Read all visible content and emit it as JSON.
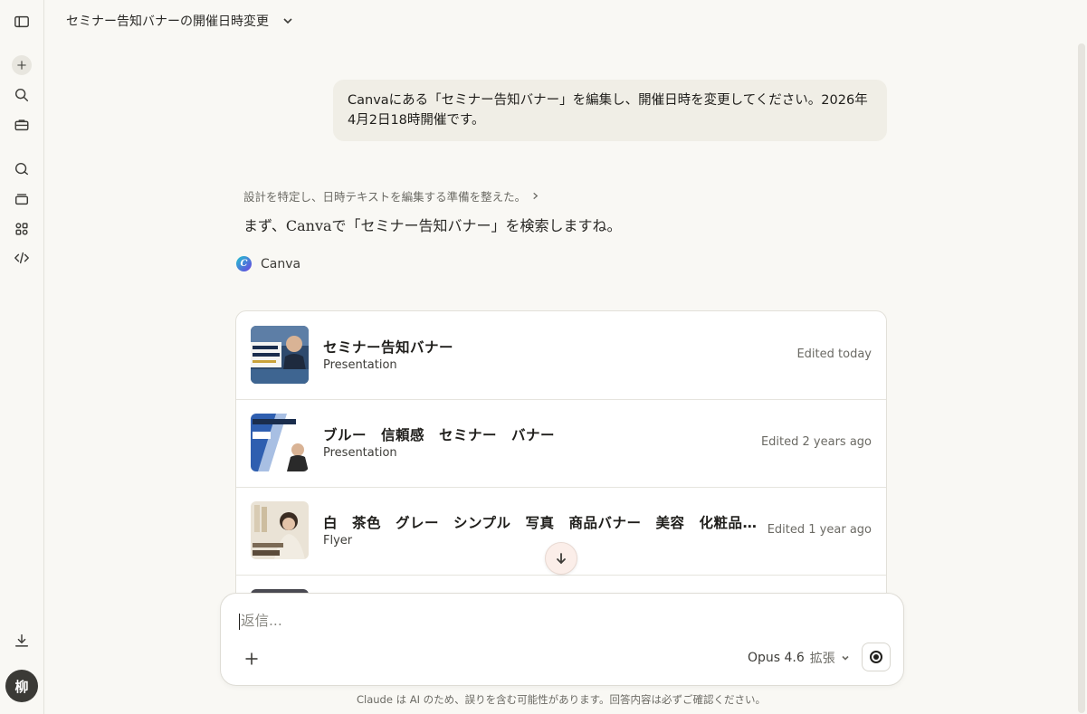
{
  "header": {
    "title": "セミナー告知バナーの開催日時変更"
  },
  "sidebar": {
    "icons": [
      "sidebar-toggle-icon",
      "new-chat-icon",
      "search-icon",
      "toolbox-icon",
      "chats-icon",
      "projects-icon",
      "artifacts-icon",
      "code-icon",
      "download-icon"
    ],
    "avatar_initial": "柳"
  },
  "conversation": {
    "user_message": "Canvaにある「セミナー告知バナー」を編集し、開催日時を変更してください。2026年4月2日18時開催です。",
    "thinking_summary": "設計を特定し、日時テキストを編集する準備を整えた。",
    "assistant_text": "まず、Canvaで「セミナー告知バナー」を検索しますね。",
    "tool_name": "Canva",
    "tool_logo_letter": "C"
  },
  "results": [
    {
      "title": "セミナー告知バナー",
      "type": "Presentation",
      "edited": "Edited today"
    },
    {
      "title": "ブルー　信頼感　セミナー　バナー",
      "type": "Presentation",
      "edited": "Edited 2 years ago"
    },
    {
      "title": "白　茶色　グレー　シンプル　写真　商品バナー　美容　化粧品...",
      "type": "Flyer",
      "edited": "Edited 1 year ago"
    }
  ],
  "composer": {
    "placeholder": "返信...",
    "model": "Opus 4.6",
    "mode": "拡張"
  },
  "footer": {
    "disclaimer": "Claude は AI のため、誤りを含む可能性があります。回答内容は必ずご確認ください。"
  }
}
